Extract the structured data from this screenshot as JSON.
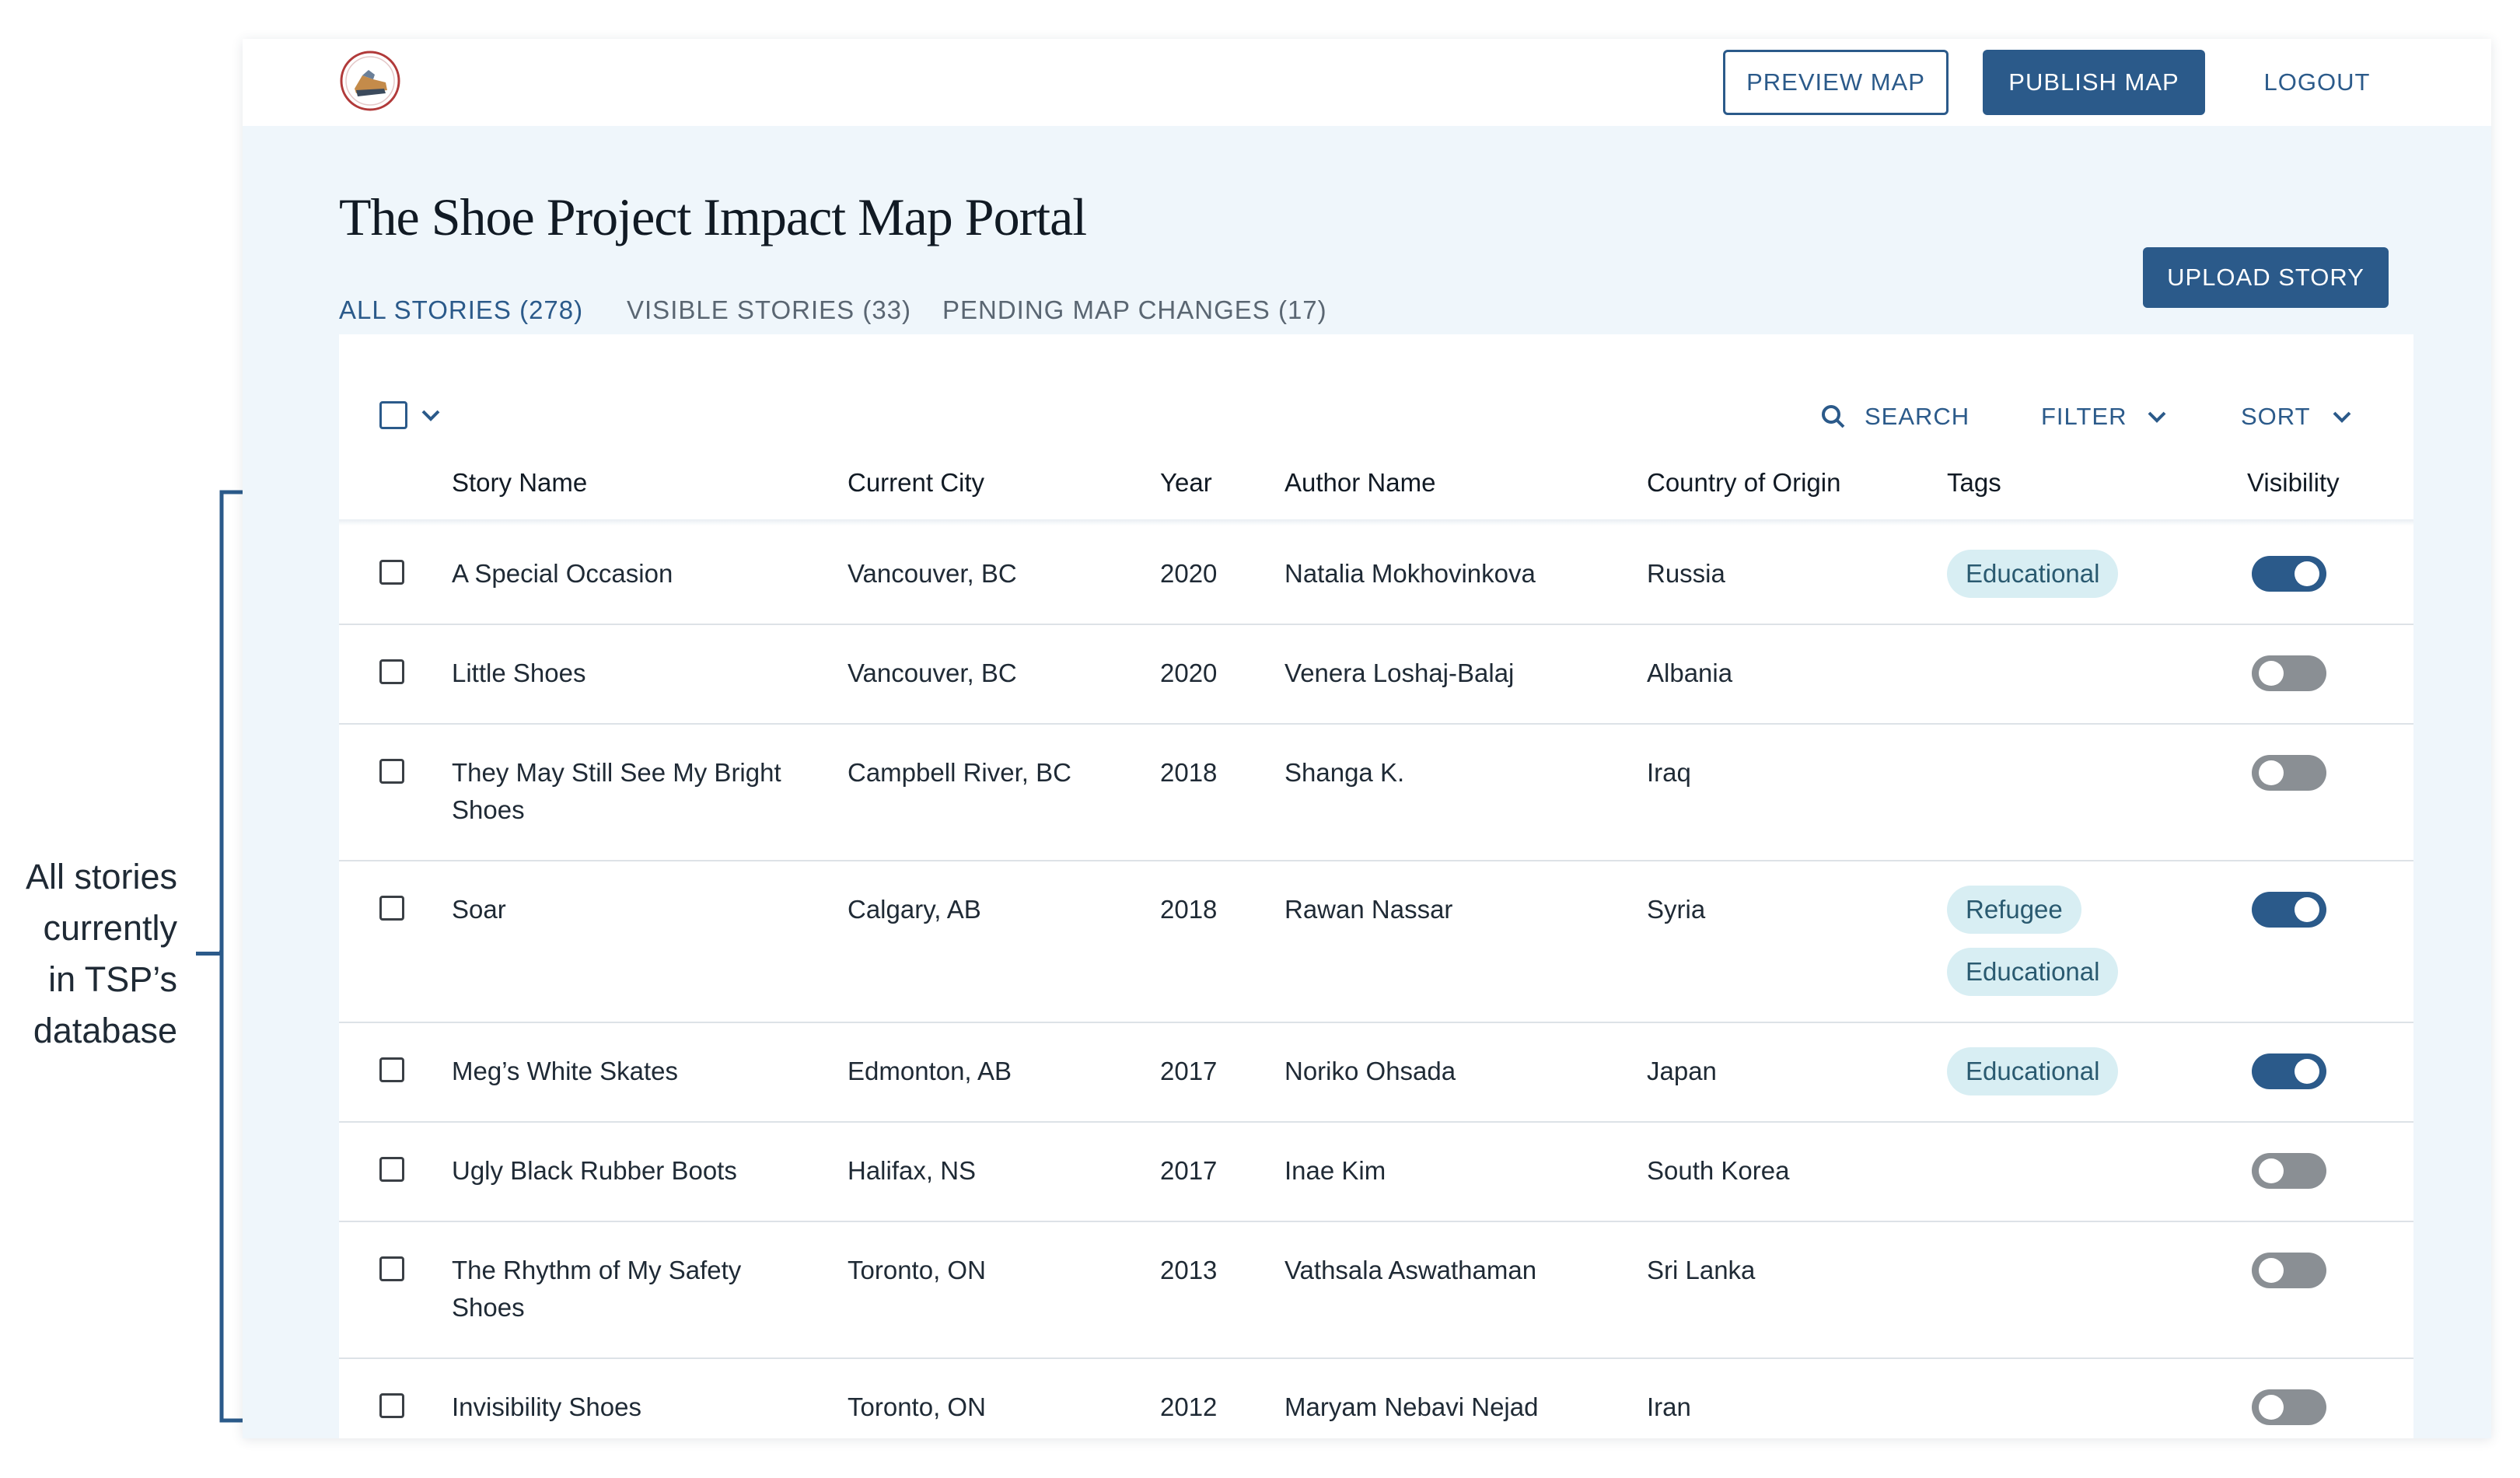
{
  "annotation": {
    "lines": [
      "All stories",
      "currently",
      "in TSP’s",
      "database"
    ]
  },
  "header": {
    "preview_label": "PREVIEW MAP",
    "publish_label": "PUBLISH MAP",
    "logout_label": "LOGOUT"
  },
  "page": {
    "title": "The Shoe Project Impact Map Portal",
    "upload_label": "UPLOAD STORY"
  },
  "tabs": [
    {
      "label": "ALL STORIES (278)",
      "active": true
    },
    {
      "label": "VISIBLE STORIES (33)",
      "active": false
    },
    {
      "label": "PENDING MAP CHANGES (17)",
      "active": false
    }
  ],
  "toolbar": {
    "search_label": "SEARCH",
    "filter_label": "FILTER",
    "sort_label": "SORT"
  },
  "columns": {
    "story_name": "Story Name",
    "current_city": "Current City",
    "year": "Year",
    "author_name": "Author Name",
    "country": "Country of Origin",
    "tags": "Tags",
    "visibility": "Visibility"
  },
  "rows": [
    {
      "name": "A Special Occasion",
      "city": "Vancouver, BC",
      "year": "2020",
      "author": "Natalia Mokhovinkova",
      "country": "Russia",
      "tags": [
        "Educational"
      ],
      "visible": true
    },
    {
      "name": "Little Shoes",
      "city": "Vancouver, BC",
      "year": "2020",
      "author": "Venera Loshaj-Balaj",
      "country": "Albania",
      "tags": [],
      "visible": false
    },
    {
      "name": "They May Still See My Bright Shoes",
      "city": "Campbell River, BC",
      "year": "2018",
      "author": "Shanga K.",
      "country": "Iraq",
      "tags": [],
      "visible": false
    },
    {
      "name": "Soar",
      "city": "Calgary, AB",
      "year": "2018",
      "author": "Rawan Nassar",
      "country": "Syria",
      "tags": [
        "Refugee",
        "Educational"
      ],
      "visible": true
    },
    {
      "name": "Meg’s White Skates",
      "city": "Edmonton, AB",
      "year": "2017",
      "author": "Noriko Ohsada",
      "country": "Japan",
      "tags": [
        "Educational"
      ],
      "visible": true
    },
    {
      "name": "Ugly Black Rubber Boots",
      "city": "Halifax, NS",
      "year": "2017",
      "author": "Inae Kim",
      "country": "South Korea",
      "tags": [],
      "visible": false
    },
    {
      "name": "The Rhythm of My Safety Shoes",
      "city": "Toronto, ON",
      "year": "2013",
      "author": "Vathsala Aswathaman",
      "country": "Sri Lanka",
      "tags": [],
      "visible": false
    },
    {
      "name": "Invisibility Shoes",
      "city": "Toronto, ON",
      "year": "2012",
      "author": "Maryam Nebavi Nejad",
      "country": "Iran",
      "tags": [],
      "visible": false
    }
  ],
  "colors": {
    "accent": "#2b5a8a",
    "page_background": "#eff6fb",
    "tag_background": "#d8eef3",
    "toggle_off": "#8a8f94"
  },
  "icons": {
    "logo": "shoe-project-logo-icon",
    "search": "search-icon",
    "dropdown": "chevron-down-icon"
  }
}
